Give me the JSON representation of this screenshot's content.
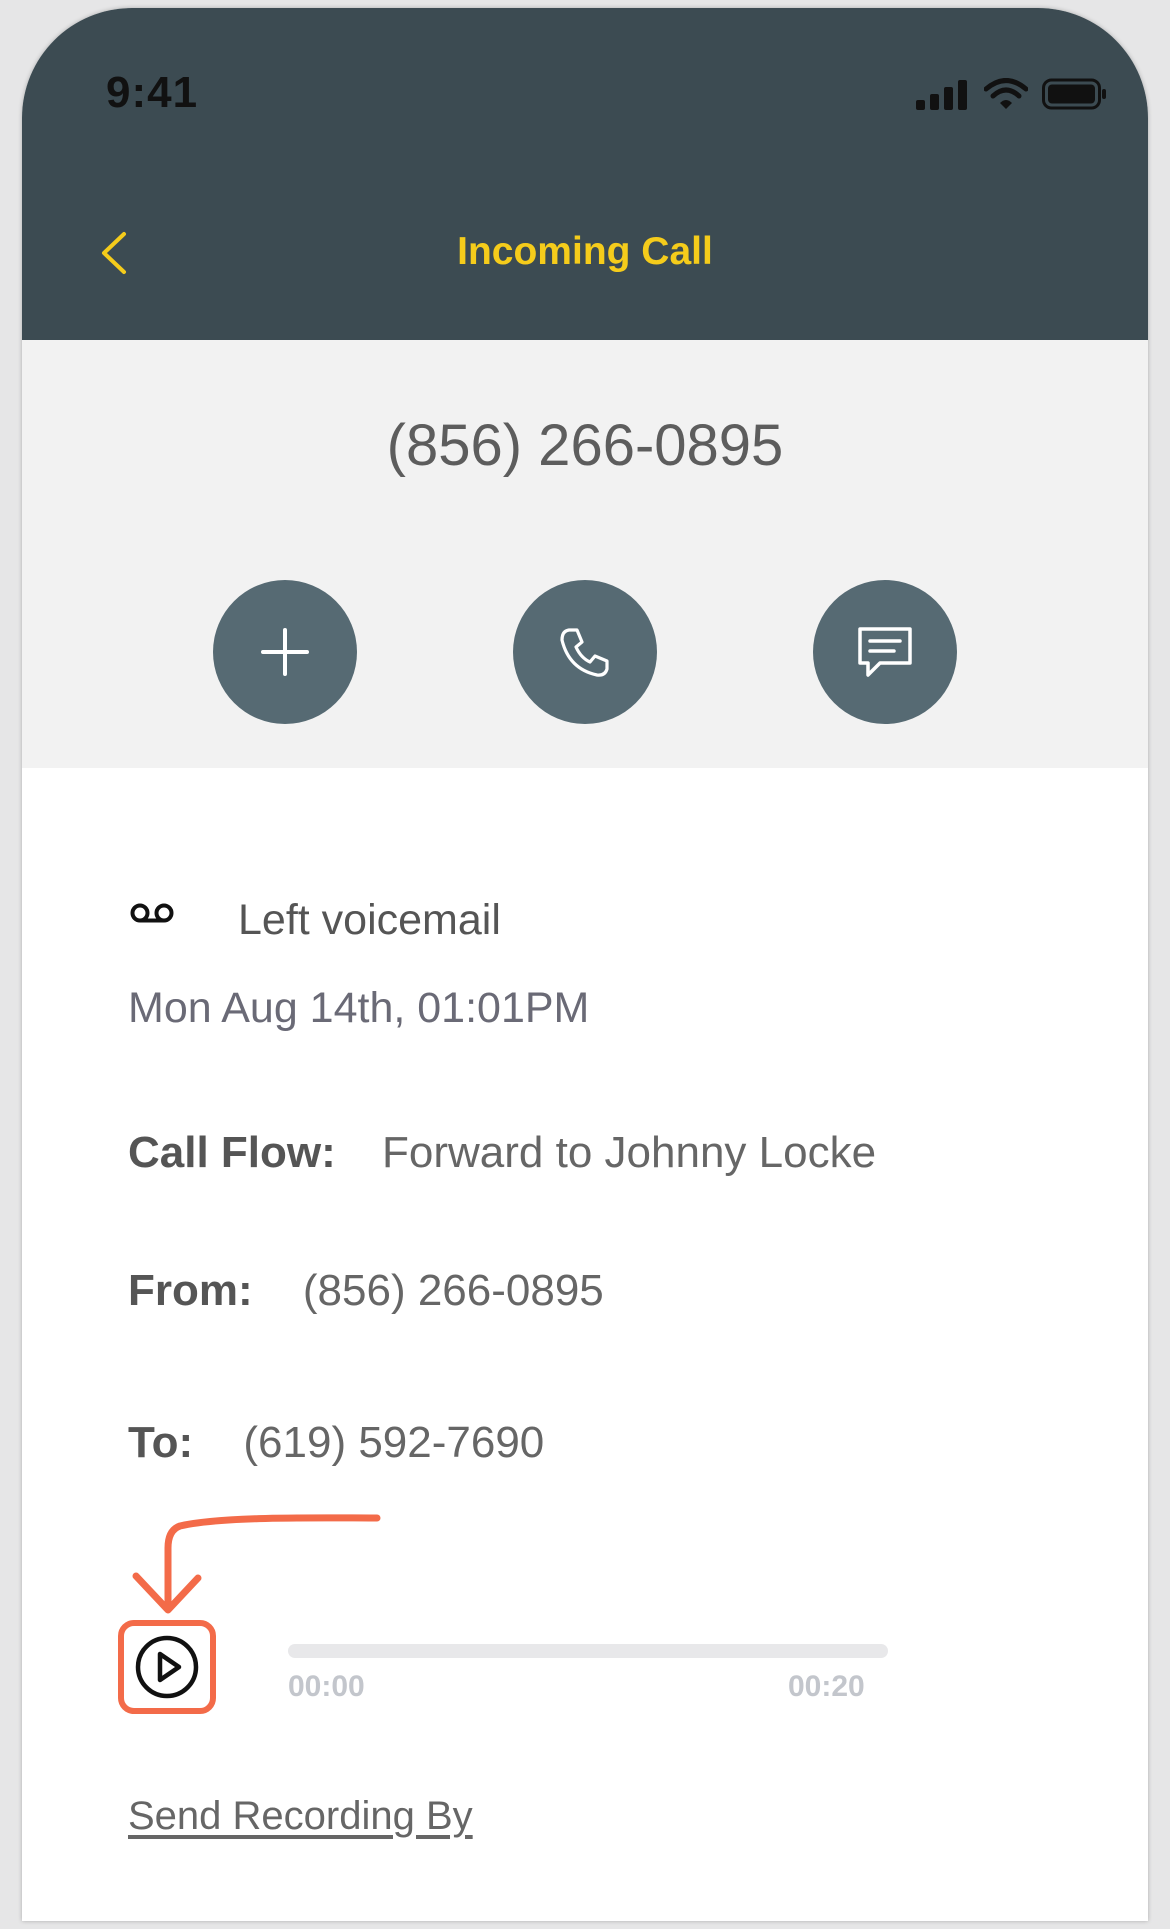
{
  "status_bar": {
    "time": "9:41"
  },
  "header": {
    "title": "Incoming Call"
  },
  "contact": {
    "phone": "(856) 266-0895"
  },
  "actions": [
    {
      "name": "add-contact-button",
      "icon": "plus-icon"
    },
    {
      "name": "call-button",
      "icon": "phone-icon"
    },
    {
      "name": "message-button",
      "icon": "message-icon"
    }
  ],
  "voicemail": {
    "label": "Left voicemail",
    "date": "Mon Aug 14th, 01:01PM"
  },
  "call_flow": {
    "label": "Call Flow:",
    "value": "Forward to Johnny Locke"
  },
  "from": {
    "label": "From:",
    "value": "(856) 266-0895"
  },
  "to": {
    "label": "To:",
    "value": "(619) 592-7690"
  },
  "player": {
    "current_time": "00:00",
    "duration": "00:20",
    "progress": 0
  },
  "send_recording": {
    "label": "Send Recording By"
  },
  "colors": {
    "header_bg": "#3c4b52",
    "accent": "#f5cc1b",
    "button_bg": "#566a73",
    "highlight": "#f36b49"
  }
}
